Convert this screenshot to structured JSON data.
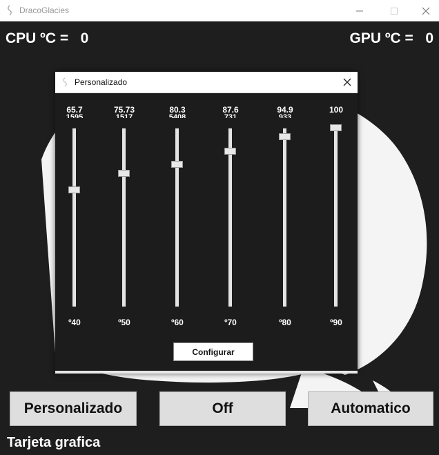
{
  "window": {
    "title": "DracoGlacies",
    "minimize_icon": "minimize-icon",
    "maximize_icon": "maximize-icon",
    "close_icon": "close-icon"
  },
  "header": {
    "cpu_label": "CPU ºC =",
    "cpu_value": "0",
    "gpu_label": "GPU ºC =",
    "gpu_value": "0"
  },
  "dialog": {
    "title": "Personalizado",
    "configure_label": "Configurar",
    "sliders": [
      {
        "temp": "65.7",
        "rpm": "1595",
        "tick": "º40",
        "level": 0.35
      },
      {
        "temp": "75.73",
        "rpm": "1517",
        "tick": "º50",
        "level": 0.255
      },
      {
        "temp": "80.3",
        "rpm": "5408",
        "tick": "º60",
        "level": 0.205
      },
      {
        "temp": "87.6",
        "rpm": "731",
        "tick": "º70",
        "level": 0.13
      },
      {
        "temp": "94.9",
        "rpm": "933",
        "tick": "º80",
        "level": 0.05
      },
      {
        "temp": "100",
        "rpm": "",
        "tick": "º90",
        "level": 0.0
      }
    ]
  },
  "modes": {
    "custom_label": "Personalizado",
    "off_label": "Off",
    "auto_label": "Automatico"
  },
  "footer": {
    "label": "Tarjeta grafica"
  },
  "colors": {
    "background": "#1e1e1e",
    "art": "#f4f4f4",
    "button": "#dedede"
  }
}
